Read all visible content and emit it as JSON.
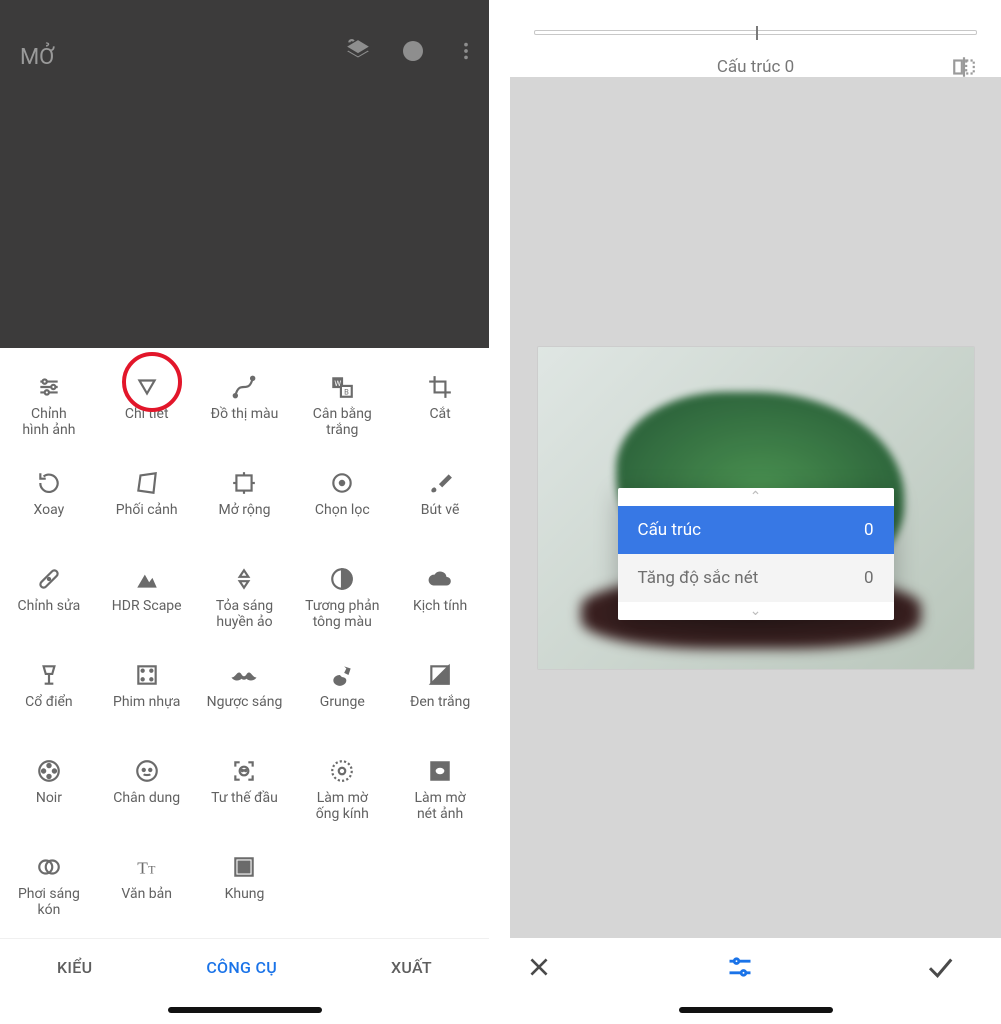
{
  "left": {
    "open_label": "MỞ",
    "tools": [
      [
        {
          "icon": "tune",
          "label": "Chỉnh\nhình ảnh"
        },
        {
          "icon": "triangle-down",
          "label": "Chi tiết"
        },
        {
          "icon": "curve",
          "label": "Đồ thị màu"
        },
        {
          "icon": "wb",
          "label": "Cân bằng\ntrắng"
        },
        {
          "icon": "crop",
          "label": "Cắt"
        }
      ],
      [
        {
          "icon": "rotate",
          "label": "Xoay"
        },
        {
          "icon": "perspective",
          "label": "Phối cảnh"
        },
        {
          "icon": "expand",
          "label": "Mở rộng"
        },
        {
          "icon": "target",
          "label": "Chọn lọc"
        },
        {
          "icon": "brush",
          "label": "Bút vẽ"
        }
      ],
      [
        {
          "icon": "bandage",
          "label": "Chỉnh sửa"
        },
        {
          "icon": "mountains",
          "label": "HDR Scape"
        },
        {
          "icon": "glamour",
          "label": "Tỏa sáng\nhuyền ảo"
        },
        {
          "icon": "contrast",
          "label": "Tương phản\ntông màu"
        },
        {
          "icon": "cloud",
          "label": "Kịch tính"
        }
      ],
      [
        {
          "icon": "lamp",
          "label": "Cổ điển"
        },
        {
          "icon": "film",
          "label": "Phim nhựa"
        },
        {
          "icon": "mustache",
          "label": "Ngược sáng"
        },
        {
          "icon": "guitar",
          "label": "Grunge"
        },
        {
          "icon": "bw",
          "label": "Đen trắng"
        }
      ],
      [
        {
          "icon": "reel",
          "label": "Noir"
        },
        {
          "icon": "face",
          "label": "Chân dung"
        },
        {
          "icon": "face-detect",
          "label": "Tư thế đầu"
        },
        {
          "icon": "lens-blur",
          "label": "Làm mờ\nống kính"
        },
        {
          "icon": "vignette",
          "label": "Làm mờ\nnét ảnh"
        }
      ],
      [
        {
          "icon": "double-expose",
          "label": "Phơi sáng\nkón"
        },
        {
          "icon": "text",
          "label": "Văn bản"
        },
        {
          "icon": "frame",
          "label": "Khung"
        }
      ]
    ],
    "tabs": {
      "styles": "KIỂU",
      "tools": "CÔNG CỤ",
      "export": "XUẤT"
    },
    "highlight": "Chi tiết"
  },
  "right": {
    "status_label": "Cấu trúc",
    "status_value": 0,
    "slider_value": 0,
    "options": [
      {
        "label": "Cấu trúc",
        "value": 0,
        "selected": true
      },
      {
        "label": "Tăng độ sắc nét",
        "value": 0,
        "selected": false
      }
    ]
  }
}
